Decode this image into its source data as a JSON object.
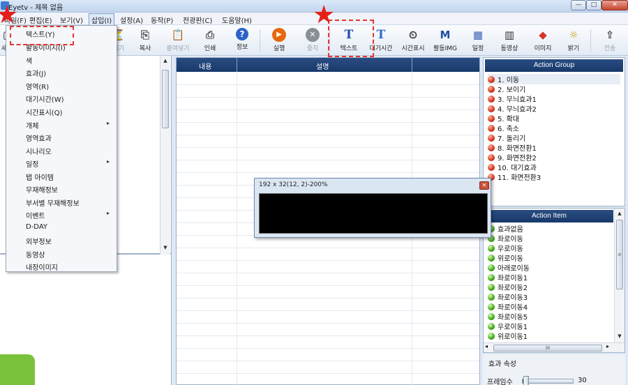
{
  "window": {
    "title": "Eyetv - 제목 없음",
    "min_glyph": "—",
    "max_glyph": "□",
    "close_glyph": "✕"
  },
  "menubar": [
    "파일(F)",
    "편집(E)",
    "보기(V)",
    "삽입(I)",
    "설정(A)",
    "동작(P)",
    "전광판(C)",
    "도움말(H)"
  ],
  "toolbar": {
    "items": [
      {
        "label": "새",
        "icon": "new-icon",
        "glyph": "▢",
        "disabled": false
      },
      {
        "label": "대기",
        "icon": "wait-icon",
        "glyph": "⏳",
        "disabled": true
      },
      {
        "label": "복사",
        "icon": "copy-icon",
        "glyph": "⎘",
        "disabled": false
      },
      {
        "label": "붙여넣기",
        "icon": "paste-icon",
        "glyph": "📋",
        "disabled": true
      },
      {
        "label": "인쇄",
        "icon": "printer-icon",
        "glyph": "⎙",
        "disabled": false
      },
      {
        "label": "정보",
        "icon": "help-icon",
        "glyph": "?",
        "disabled": false
      },
      {
        "label": "실행",
        "icon": "play-icon",
        "glyph": "▶",
        "disabled": false
      },
      {
        "label": "중지",
        "icon": "stop-icon",
        "glyph": "✕",
        "disabled": true
      },
      {
        "label": "텍스트",
        "icon": "text-icon",
        "glyph": "T",
        "disabled": false
      },
      {
        "label": "대기시간",
        "icon": "wait-time-icon",
        "glyph": "T",
        "disabled": false
      },
      {
        "label": "시간표시",
        "icon": "clock-icon",
        "glyph": "⏲",
        "disabled": false
      },
      {
        "label": "활동IMG",
        "icon": "motion-img-icon",
        "glyph": "M",
        "disabled": false
      },
      {
        "label": "일정",
        "icon": "schedule-icon",
        "glyph": "▦",
        "disabled": false
      },
      {
        "label": "동영상",
        "icon": "video-icon",
        "glyph": "▥",
        "disabled": false
      },
      {
        "label": "이미지",
        "icon": "image-icon",
        "glyph": "◆",
        "disabled": false
      },
      {
        "label": "밝기",
        "icon": "brightness-icon",
        "glyph": "☼",
        "disabled": false
      },
      {
        "label": "전송",
        "icon": "send-icon",
        "glyph": "⇪",
        "disabled": true
      }
    ]
  },
  "insert_menu": {
    "items": [
      {
        "label": "텍스트(Y)",
        "submenu": false
      },
      {
        "label": "활동이미지(I)",
        "submenu": false
      },
      {
        "label": "색",
        "submenu": false
      },
      {
        "label": "효과(J)",
        "submenu": false
      },
      {
        "label": "영역(R)",
        "submenu": false
      },
      {
        "label": "대기시간(W)",
        "submenu": false
      },
      {
        "label": "시간표시(Q)",
        "submenu": false
      },
      {
        "label": "개체",
        "submenu": true
      },
      {
        "label": "영역효과",
        "submenu": false
      },
      {
        "label": "시나리오",
        "submenu": false
      },
      {
        "label": "일정",
        "submenu": true
      },
      {
        "label": "탭 아이템",
        "submenu": false
      },
      {
        "label": "무재해정보",
        "submenu": false
      },
      {
        "label": "부서별 무재해정보",
        "submenu": false
      },
      {
        "label": "이벤트",
        "submenu": true
      },
      {
        "label": "D-DAY",
        "submenu": false
      },
      {
        "label": "외부정보",
        "submenu": false
      },
      {
        "label": "동영상",
        "submenu": false
      },
      {
        "label": "내장이미지",
        "submenu": false
      }
    ],
    "submenu_glyph": "▸"
  },
  "grid": {
    "columns": [
      "내용",
      "설명"
    ]
  },
  "popup": {
    "title": "192 x 32(12, 2)-200%",
    "close_glyph": "✕"
  },
  "action_group": {
    "title": "Action Group",
    "items": [
      "1. 이동",
      "2. 보이기",
      "3. 무늬효과1",
      "4. 무늬효과2",
      "5. 확대",
      "6. 축소",
      "7. 돌리기",
      "8. 화면전환1",
      "9. 화면전환2",
      "10. 대기효과",
      "11. 화면전환3"
    ]
  },
  "action_item": {
    "title": "Action Item",
    "items": [
      "효과없음",
      "좌로이동",
      "우로이동",
      "위로이동",
      "아래로이동",
      "좌로이동1",
      "좌로이동2",
      "좌로이동3",
      "좌로이동4",
      "좌로이동5",
      "우로이동1",
      "위로이동1"
    ]
  },
  "properties": {
    "title": "효과 속성",
    "frame_label": "프레임수",
    "frame_value": "30",
    "frame_level": 0.1
  },
  "scroll": {
    "up": "▲",
    "down": "▼",
    "left": "◂",
    "right": "▸",
    "grip": "≡",
    "hgrip": "III"
  },
  "colors": {
    "accent": "#1f4478",
    "highlight": "#e6352f",
    "status_green": "#7ac23c"
  }
}
